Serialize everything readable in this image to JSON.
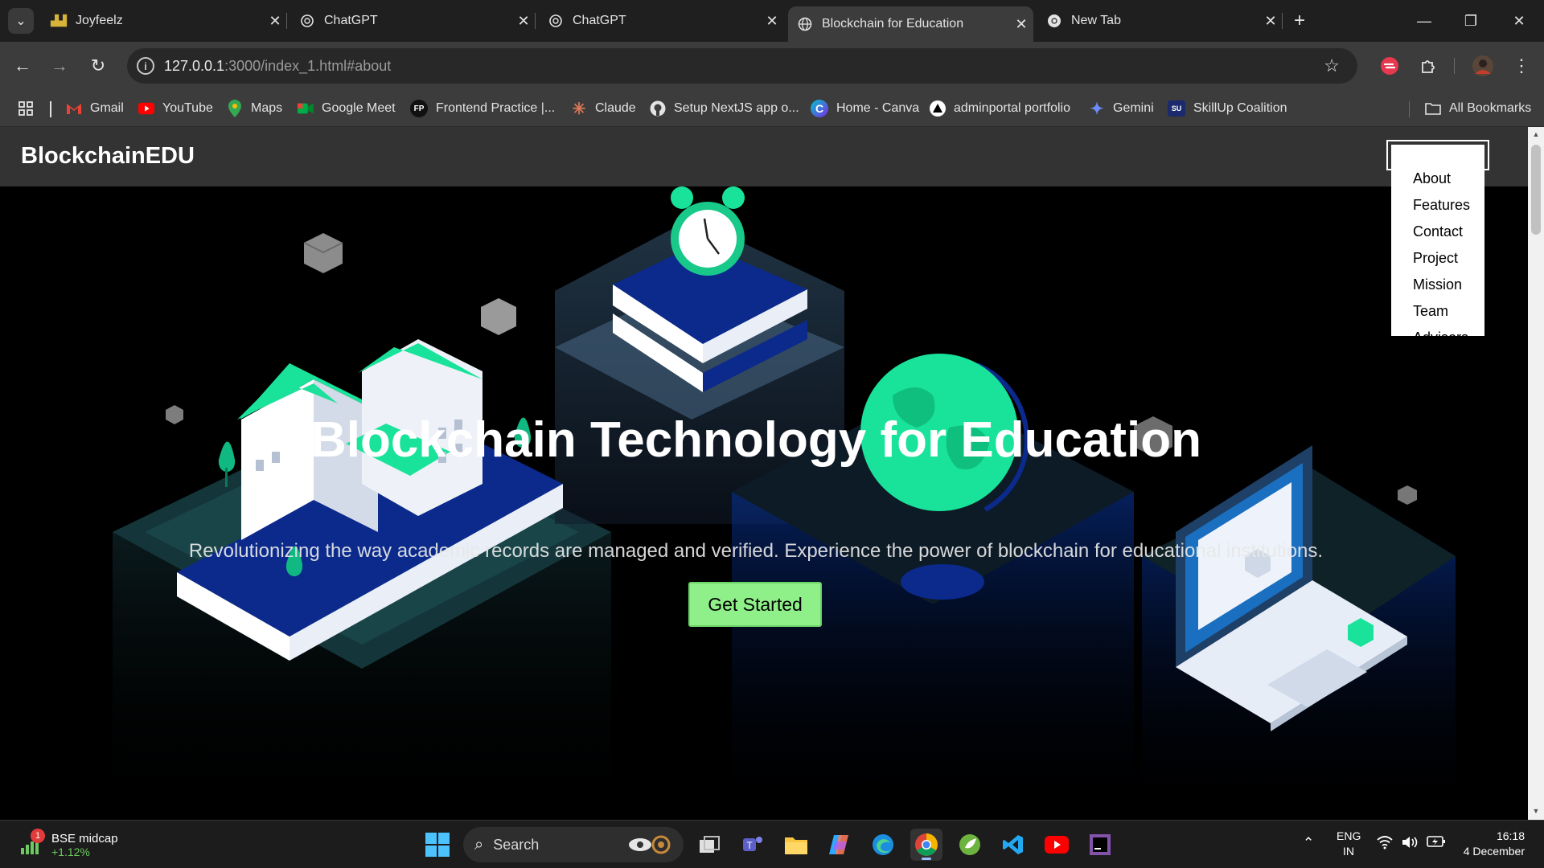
{
  "browser": {
    "tabs": [
      {
        "title": "Joyfeelz",
        "icon": "joyfeelz-favicon",
        "active": false
      },
      {
        "title": "ChatGPT",
        "icon": "chatgpt-icon",
        "active": false
      },
      {
        "title": "ChatGPT",
        "icon": "chatgpt-icon",
        "active": false
      },
      {
        "title": "Blockchain for Education",
        "icon": "globe-icon",
        "active": true
      },
      {
        "title": "New Tab",
        "icon": "chrome-icon",
        "active": false
      }
    ],
    "close_glyph": "✕",
    "new_tab_glyph": "+",
    "window_controls": {
      "minimize": "—",
      "restore": "❐",
      "close": "✕"
    },
    "url_host": "127.0.0.1",
    "url_rest": ":3000/index_1.html#about"
  },
  "bookmarks": {
    "apps_icon": "apps-grid-icon",
    "items": [
      {
        "label": "Gmail",
        "icon": "gmail-icon"
      },
      {
        "label": "YouTube",
        "icon": "youtube-icon"
      },
      {
        "label": "Maps",
        "icon": "maps-icon"
      },
      {
        "label": "Google Meet",
        "icon": "google-meet-icon"
      },
      {
        "label": "Frontend Practice |...",
        "icon": "fp-icon",
        "icon_text": "FP"
      },
      {
        "label": "Claude",
        "icon": "claude-icon"
      },
      {
        "label": "Setup NextJS app o...",
        "icon": "github-icon"
      },
      {
        "label": "Home - Canva",
        "icon": "canva-icon",
        "icon_text": "C"
      },
      {
        "label": "adminportal portfolio",
        "icon": "triangle-icon"
      },
      {
        "label": "Gemini",
        "icon": "gemini-icon"
      },
      {
        "label": "SkillUp Coalition",
        "icon": "skillup-icon",
        "icon_text": "SU"
      }
    ],
    "all_bookmarks": "All Bookmarks"
  },
  "site": {
    "brand": "BlockchainEDU",
    "nav": [
      "About",
      "Features",
      "Contact",
      "Project",
      "Mission",
      "Team",
      "Advisors"
    ],
    "hero_title": "Blockchain Technology for Education",
    "hero_subtitle": "Revolutionizing the way academic records are managed and verified. Experience the power of blockchain for educational institutions.",
    "cta": "Get Started",
    "colors": {
      "accent_green": "#8ff08a",
      "header_bg": "#333333",
      "mint": "#19e39a",
      "navy": "#0b2a8c"
    }
  },
  "taskbar": {
    "widget_title": "BSE midcap",
    "widget_value": "+1.12%",
    "widget_badge": "1",
    "search_placeholder": "Search",
    "apps": [
      "file-explorer-icon",
      "teams-icon",
      "folder-icon",
      "copilot-icon",
      "edge-icon",
      "chrome-icon",
      "spring-icon",
      "vscode-icon",
      "youtube-icon",
      "jetbrains-icon"
    ],
    "lang_top": "ENG",
    "lang_bottom": "IN",
    "time": "16:18",
    "date": "4 December"
  }
}
